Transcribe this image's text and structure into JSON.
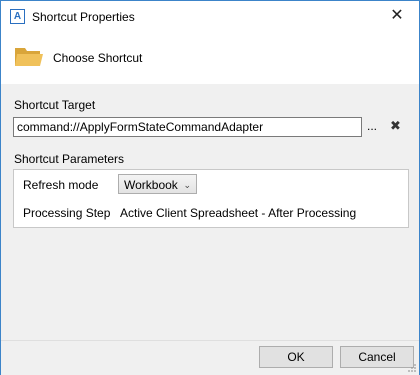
{
  "window": {
    "title": "Shortcut Properties",
    "app_icon_letter": "A",
    "close_glyph": "✕"
  },
  "header": {
    "title": "Choose Shortcut"
  },
  "shortcut_target": {
    "label": "Shortcut Target",
    "value": "command://ApplyFormStateCommandAdapter",
    "browse_label": "...",
    "clear_glyph": "✖"
  },
  "parameters": {
    "label": "Shortcut Parameters",
    "refresh_mode": {
      "label": "Refresh mode",
      "selected": "Workbook"
    },
    "processing_step": {
      "label": "Processing Step",
      "value": "Active Client Spreadsheet - After Processing"
    }
  },
  "footer": {
    "ok_label": "OK",
    "cancel_label": "Cancel"
  },
  "colors": {
    "window_border": "#3c84c9",
    "dialog_bg": "#f0f0f0",
    "folder": "#e9b84a"
  }
}
